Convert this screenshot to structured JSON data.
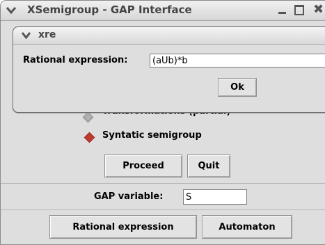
{
  "window": {
    "title": "XSemigroup - GAP Interface",
    "menu_icon": "chevron-down-icon",
    "minimize_icon": "minimize-icon",
    "maximize_icon": "maximize-icon",
    "close_icon": "close-icon",
    "close_glyph": "✖"
  },
  "dialog": {
    "title": "xre",
    "rational_expression_label": "Rational expression:",
    "rational_expression_value": "(aUb)*b",
    "ok_label": "Ok"
  },
  "options": {
    "partial_label": "Transformations (partial)",
    "syntactic_label": "Syntatic semigroup",
    "syntactic_selected": true
  },
  "actions": {
    "proceed_label": "Proceed",
    "quit_label": "Quit"
  },
  "gap": {
    "label": "GAP variable:",
    "value": "S"
  },
  "bottom": {
    "rational_button_label": "Rational expression",
    "automaton_button_label": "Automaton"
  },
  "colors": {
    "selected_radio": "#c0392b",
    "background": "#dedede"
  }
}
